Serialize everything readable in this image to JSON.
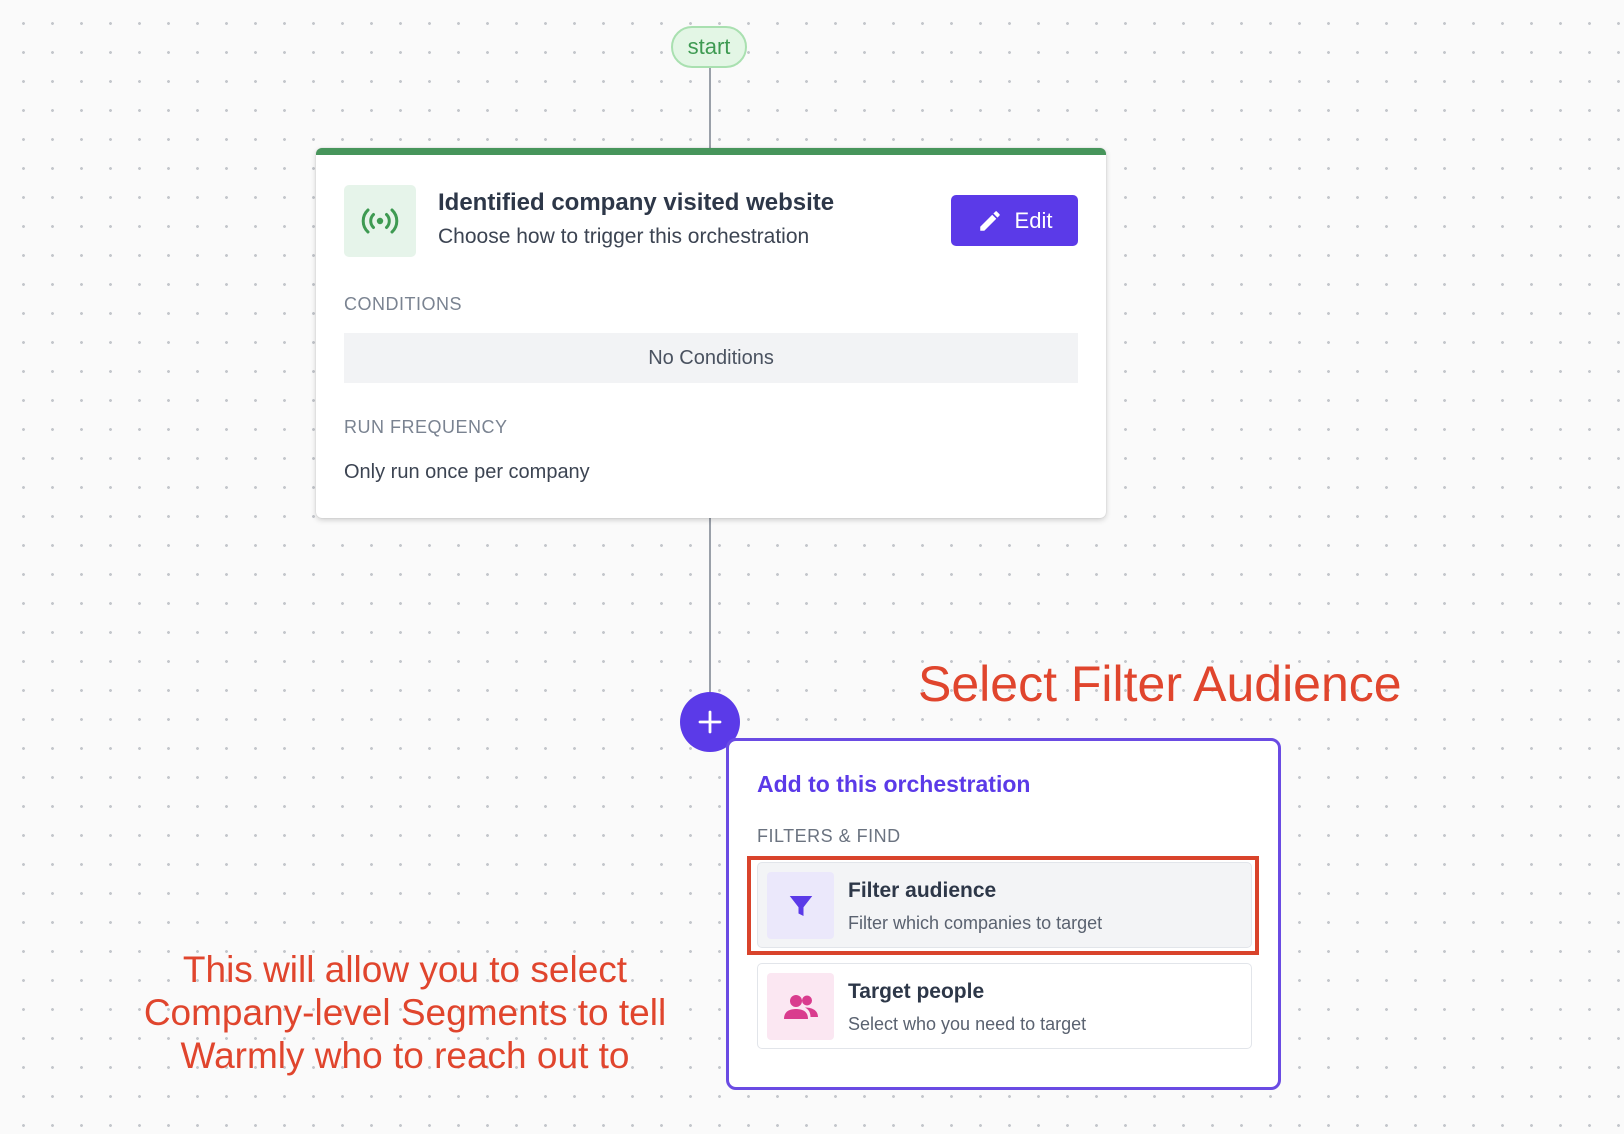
{
  "flow": {
    "start_label": "start"
  },
  "trigger": {
    "title": "Identified company visited website",
    "subtitle": "Choose how to trigger this orchestration",
    "icon": "broadcast-signal-icon",
    "edit_label": "Edit",
    "conditions_label": "CONDITIONS",
    "conditions_value": "No Conditions",
    "frequency_label": "RUN FREQUENCY",
    "frequency_value": "Only run once per company",
    "accent_color": "#47955b"
  },
  "add_panel": {
    "title": "Add to this orchestration",
    "section_label": "FILTERS & FIND",
    "options": [
      {
        "title": "Filter audience",
        "description": "Filter which companies to target",
        "icon": "funnel-icon",
        "selected": true
      },
      {
        "title": "Target people",
        "description": "Select who you need to target",
        "icon": "people-icon",
        "selected": false
      }
    ],
    "accent_color": "#5b3ae8"
  },
  "annotations": {
    "title": "Select Filter Audience",
    "body_line1": "This will allow you to select",
    "body_line2": "Company-level Segments to tell",
    "body_line3": "Warmly who to reach out to",
    "color": "#e0452d"
  }
}
